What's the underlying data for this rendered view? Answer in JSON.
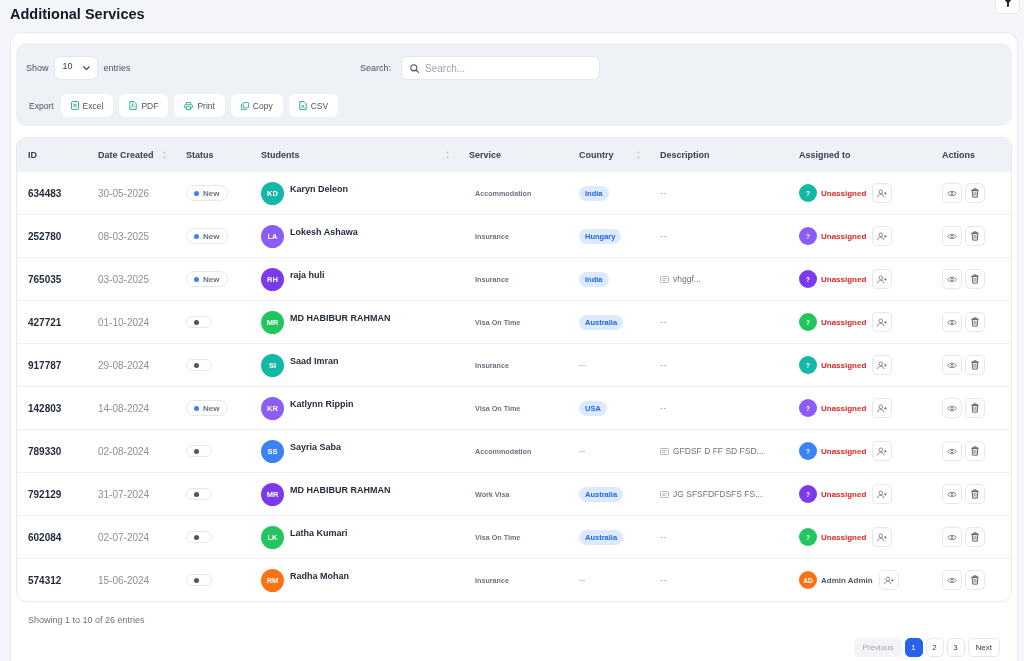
{
  "page": {
    "title": "Additional Services"
  },
  "toolbar": {
    "show_label": "Show",
    "page_size": "10",
    "entries_label": "entries",
    "search": {
      "label": "Search:",
      "placeholder": "Search..."
    },
    "export_label": "Export",
    "export_buttons": [
      {
        "kind": "excel",
        "label": "Excel"
      },
      {
        "kind": "pdf",
        "label": "PDF"
      },
      {
        "kind": "print",
        "label": "Print"
      },
      {
        "kind": "copy",
        "label": "Copy"
      },
      {
        "kind": "csv",
        "label": "CSV"
      }
    ]
  },
  "table": {
    "columns": [
      {
        "label": "ID",
        "sortable": false
      },
      {
        "label": "Date Created",
        "sortable": true
      },
      {
        "label": "Status",
        "sortable": false
      },
      {
        "label": "Students",
        "sortable": true
      },
      {
        "label": "Service",
        "sortable": false
      },
      {
        "label": "Country",
        "sortable": true
      },
      {
        "label": "Description",
        "sortable": false
      },
      {
        "label": "Assigned to",
        "sortable": false
      },
      {
        "label": "Actions",
        "sortable": false
      }
    ],
    "rows": [
      {
        "id": "634483",
        "date": "30-05-2026",
        "status": {
          "kind": "new",
          "label": "New"
        },
        "student": {
          "initials": "KD",
          "name": "Karyn Deleon",
          "color": "#14b8a6"
        },
        "service": "Accommodation",
        "country": {
          "kind": "tag",
          "text": "India"
        },
        "description": {
          "kind": "empty",
          "text": "--"
        },
        "assignee": {
          "kind": "unassigned",
          "initials": "?",
          "name": "Unassigned",
          "color": "#14b8a6"
        }
      },
      {
        "id": "252780",
        "date": "08-03-2025",
        "status": {
          "kind": "new",
          "label": "New"
        },
        "student": {
          "initials": "LA",
          "name": "Lokesh Ashawa",
          "color": "#8b5cf6"
        },
        "service": "Insurance",
        "country": {
          "kind": "tag",
          "text": "Hungary"
        },
        "description": {
          "kind": "empty",
          "text": "--"
        },
        "assignee": {
          "kind": "unassigned",
          "initials": "?",
          "name": "Unassigned",
          "color": "#8b5cf6"
        }
      },
      {
        "id": "765035",
        "date": "03-03-2025",
        "status": {
          "kind": "new",
          "label": "New"
        },
        "student": {
          "initials": "RH",
          "name": "raja huli",
          "color": "#7c3aed"
        },
        "service": "Insurance",
        "country": {
          "kind": "tag",
          "text": "India"
        },
        "description": {
          "kind": "note",
          "text": "vhggf..."
        },
        "assignee": {
          "kind": "unassigned",
          "initials": "?",
          "name": "Unassigned",
          "color": "#7c3aed"
        }
      },
      {
        "id": "427721",
        "date": "01-10-2024",
        "status": {
          "kind": "blank"
        },
        "student": {
          "initials": "MR",
          "name": "MD HABIBUR RAHMAN",
          "color": "#22c55e"
        },
        "service": "Visa On Time",
        "country": {
          "kind": "tag",
          "text": "Australia"
        },
        "description": {
          "kind": "empty",
          "text": "--"
        },
        "assignee": {
          "kind": "unassigned",
          "initials": "?",
          "name": "Unassigned",
          "color": "#22c55e"
        }
      },
      {
        "id": "917787",
        "date": "29-08-2024",
        "status": {
          "kind": "blank"
        },
        "student": {
          "initials": "SI",
          "name": "Saad Imran",
          "color": "#14b8a6"
        },
        "service": "Insurance",
        "country": {
          "kind": "empty",
          "text": "--"
        },
        "description": {
          "kind": "empty",
          "text": "--"
        },
        "assignee": {
          "kind": "unassigned",
          "initials": "?",
          "name": "Unassigned",
          "color": "#14b8a6"
        }
      },
      {
        "id": "142803",
        "date": "14-08-2024",
        "status": {
          "kind": "new",
          "label": "New"
        },
        "student": {
          "initials": "KR",
          "name": "Katlynn Rippin",
          "color": "#8b5cf6"
        },
        "service": "Visa On Time",
        "country": {
          "kind": "tag",
          "text": "USA"
        },
        "description": {
          "kind": "empty",
          "text": "--"
        },
        "assignee": {
          "kind": "unassigned",
          "initials": "?",
          "name": "Unassigned",
          "color": "#8b5cf6"
        }
      },
      {
        "id": "789330",
        "date": "02-08-2024",
        "status": {
          "kind": "blank"
        },
        "student": {
          "initials": "SS",
          "name": "Sayria Saba",
          "color": "#3b82f6"
        },
        "service": "Accommodation",
        "country": {
          "kind": "empty",
          "text": "--"
        },
        "description": {
          "kind": "note",
          "text": "GFDSF D FF SD FSD..."
        },
        "assignee": {
          "kind": "unassigned",
          "initials": "?",
          "name": "Unassigned",
          "color": "#3b82f6"
        }
      },
      {
        "id": "792129",
        "date": "31-07-2024",
        "status": {
          "kind": "blank"
        },
        "student": {
          "initials": "MR",
          "name": "MD HABIBUR RAHMAN",
          "color": "#7c3aed"
        },
        "service": "Work Visa",
        "country": {
          "kind": "tag",
          "text": "Australia"
        },
        "description": {
          "kind": "note",
          "text": "JG SFSFDFDSFS FS..."
        },
        "assignee": {
          "kind": "unassigned",
          "initials": "?",
          "name": "Unassigned",
          "color": "#7c3aed"
        }
      },
      {
        "id": "602084",
        "date": "02-07-2024",
        "status": {
          "kind": "blank"
        },
        "student": {
          "initials": "LK",
          "name": "Latha Kumari",
          "color": "#22c55e"
        },
        "service": "Visa On Time",
        "country": {
          "kind": "tag",
          "text": "Australia"
        },
        "description": {
          "kind": "empty",
          "text": "--"
        },
        "assignee": {
          "kind": "unassigned",
          "initials": "?",
          "name": "Unassigned",
          "color": "#22c55e"
        }
      },
      {
        "id": "574312",
        "date": "15-06-2024",
        "status": {
          "kind": "blank"
        },
        "student": {
          "initials": "RM",
          "name": "Radha Mohan",
          "color": "#f97316"
        },
        "service": "Insurance",
        "country": {
          "kind": "empty",
          "text": "--"
        },
        "description": {
          "kind": "empty",
          "text": "--"
        },
        "assignee": {
          "kind": "user",
          "initials": "AD",
          "name": "Admin Admin",
          "color": "#f97316"
        }
      }
    ]
  },
  "footer": {
    "info": "Showing 1 to 10 of 26 entries",
    "pagination": {
      "previous": {
        "label": "Previous",
        "disabled": true
      },
      "pages": [
        {
          "label": "1",
          "selected": true
        },
        {
          "label": "2",
          "selected": false
        },
        {
          "label": "3",
          "selected": false
        }
      ],
      "next": {
        "label": "Next",
        "disabled": false
      }
    }
  }
}
